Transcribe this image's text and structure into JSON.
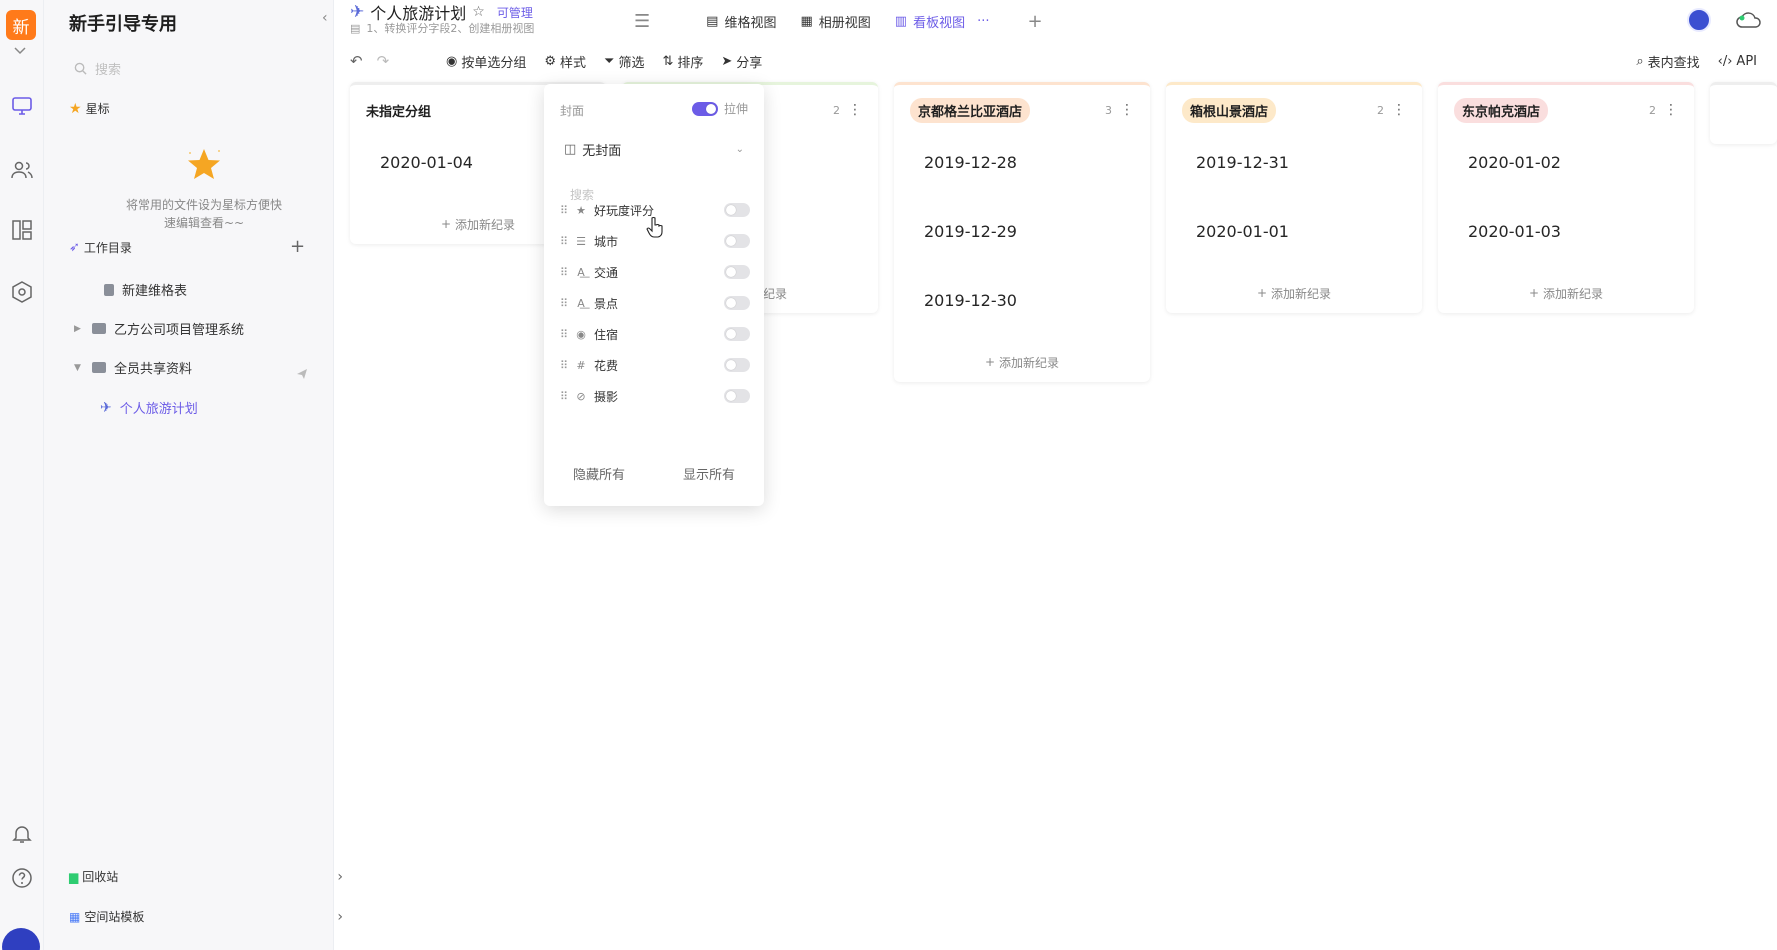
{
  "rail": {
    "logo": "新"
  },
  "sidebar": {
    "space_title": "新手引导专用",
    "search_placeholder": "搜索",
    "star_label": "星标",
    "star_empty_text": "将常用的文件设为星标方便快速编辑查看~~",
    "workdir_label": "工作目录",
    "tree": [
      {
        "label": "新建维格表",
        "type": "sheet"
      },
      {
        "label": "乙方公司项目管理系统",
        "type": "folder"
      },
      {
        "label": "全员共享资料",
        "type": "folder"
      },
      {
        "label": "个人旅游计划",
        "type": "file"
      }
    ],
    "recycle_label": "回收站",
    "template_label": "空间站模板"
  },
  "header": {
    "title": "个人旅游计划",
    "permission": "可管理",
    "description": "1、转换评分字段2、创建相册视图",
    "tabs": [
      {
        "label": "维格视图",
        "active": false
      },
      {
        "label": "相册视图",
        "active": false
      },
      {
        "label": "看板视图",
        "active": true
      }
    ]
  },
  "toolbar": {
    "group": "按单选分组",
    "style": "样式",
    "filter": "筛选",
    "sort": "排序",
    "share": "分享",
    "find": "表内查找",
    "api": "API"
  },
  "board": {
    "add_label": "添加新纪录",
    "columns": [
      {
        "name": "未指定分组",
        "count": "",
        "color": "",
        "cards": [
          "2020-01-04"
        ]
      },
      {
        "name": "",
        "count": "2",
        "color": "#e6f4dc",
        "cards": [
          "",
          ""
        ]
      },
      {
        "name": "京都格兰比亚酒店",
        "count": "3",
        "color": "#fde3cf",
        "cards": [
          "2019-12-28",
          "2019-12-29",
          "2019-12-30"
        ]
      },
      {
        "name": "箱根山景酒店",
        "count": "2",
        "color": "#fde9c9",
        "cards": [
          "2019-12-31",
          "2020-01-01"
        ]
      },
      {
        "name": "东京帕克酒店",
        "count": "2",
        "color": "#fadede",
        "cards": [
          "2020-01-02",
          "2020-01-03"
        ]
      }
    ]
  },
  "popover": {
    "cover_label": "封面",
    "stretch_label": "拉伸",
    "stretch_on": true,
    "cover_value": "无封面",
    "search_placeholder": "搜索",
    "fields": [
      {
        "label": "好玩度评分",
        "icon": "star-icon"
      },
      {
        "label": "城市",
        "icon": "list-icon"
      },
      {
        "label": "交通",
        "icon": "text-icon"
      },
      {
        "label": "景点",
        "icon": "text-icon"
      },
      {
        "label": "住宿",
        "icon": "single-select-icon"
      },
      {
        "label": "花费",
        "icon": "hash-icon"
      },
      {
        "label": "摄影",
        "icon": "attachment-icon"
      }
    ],
    "hide_all": "隐藏所有",
    "show_all": "显示所有"
  },
  "colors": {
    "accent": "#6c5ce7",
    "logo": "#ff7a1a"
  }
}
